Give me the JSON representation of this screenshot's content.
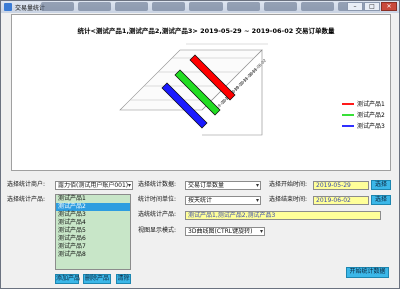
{
  "window": {
    "title": "交易量统计",
    "buttons": {
      "min": "–",
      "max": "□",
      "close": "✕"
    }
  },
  "chart_data": {
    "type": "bar",
    "title": "统计<测试产品1,测试产品2,测试产品3> 2019-05-29 ~ 2019-06-02 交易订单数量",
    "series": [
      {
        "name": "测试产品1",
        "color": "#ff0000"
      },
      {
        "name": "测试产品2",
        "color": "#22dd22"
      },
      {
        "name": "测试产品3",
        "color": "#1a1aff"
      }
    ],
    "categories": [
      "2019-05-29",
      "2019-05-30",
      "2019-05-31",
      "2019-06-01",
      "2019-06-02"
    ],
    "legend": "right"
  },
  "form": {
    "merchant_label": "选择统计商户:",
    "merchant_value": "露力佰(测试用户账户001)",
    "product_label": "选择统计产品:",
    "products": [
      "测试产品1",
      "测试产品2",
      "测试产品3",
      "测试产品4",
      "测试产品5",
      "测试产品6",
      "测试产品7",
      "测试产品8"
    ],
    "selected_product_index": 1,
    "add_button": "添加产品",
    "delete_button": "删除产品",
    "clear_button": "清除",
    "data_label": "选择统计数据:",
    "data_value": "交易订单数量",
    "unit_label": "统计时间单位:",
    "unit_value": "按天统计",
    "chosen_label": "选统统计产品:",
    "chosen_value": "测试产品1,测试产品2,测试产品3",
    "view_label": "视图显示模式:",
    "view_value": "3D曲线图(CTRL键旋转)",
    "start_label": "选择开始时间:",
    "start_value": "2019-05-29",
    "end_label": "选择结束时间:",
    "end_value": "2019-06-02",
    "choose_button": "选择",
    "start_stat_button": "开始统计数据"
  }
}
